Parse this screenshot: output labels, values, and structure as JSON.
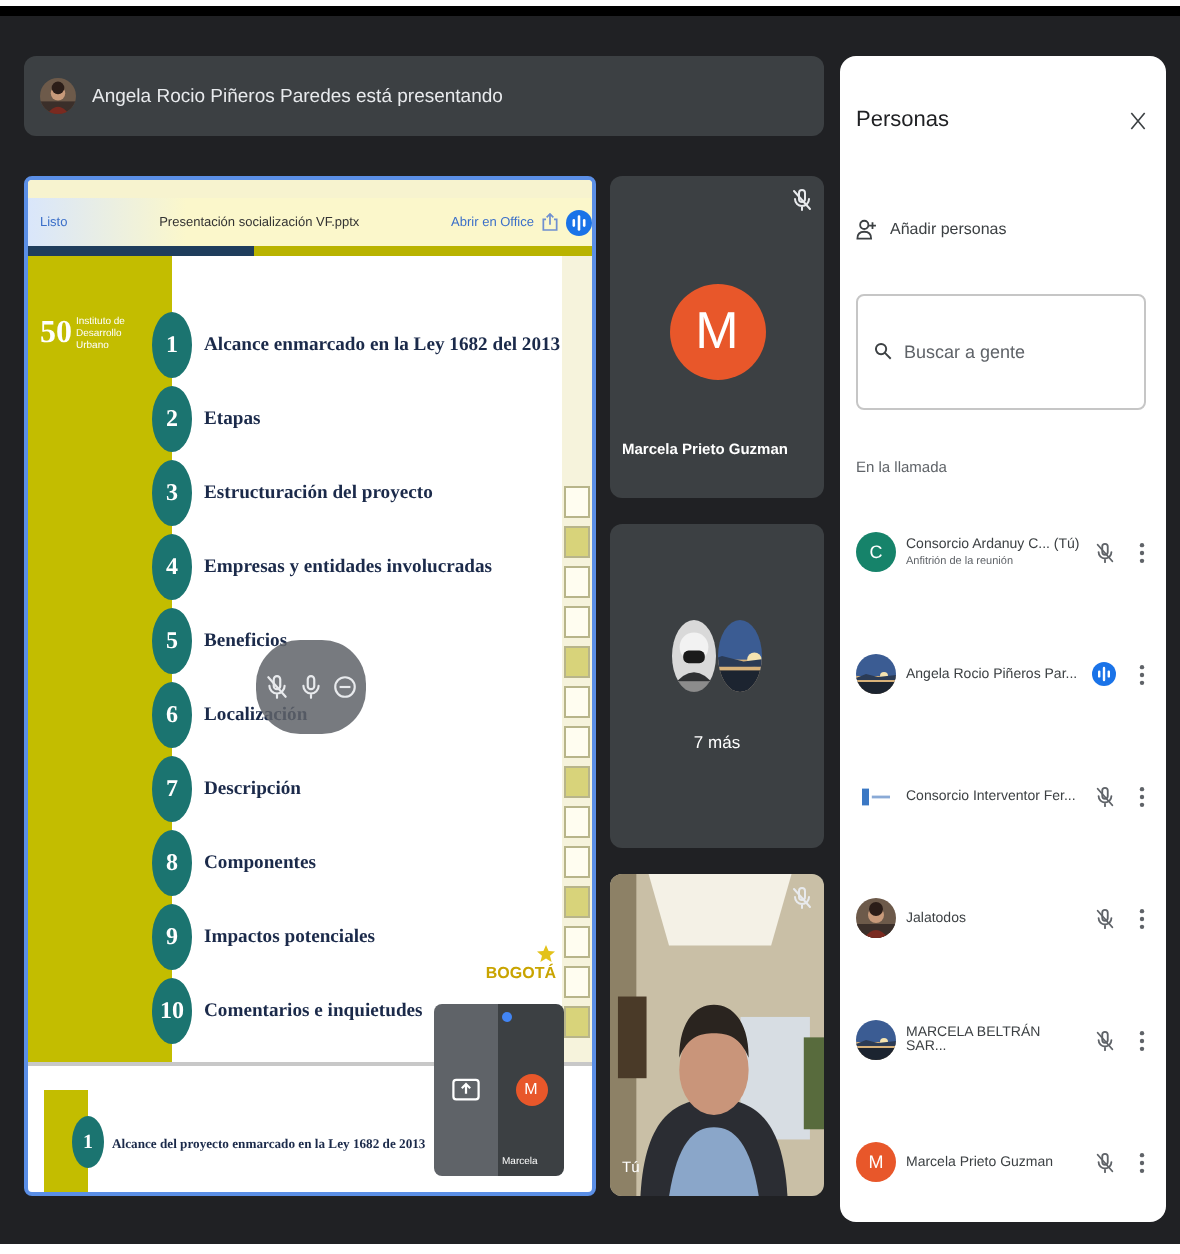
{
  "presenter_bar": {
    "text": "Angela Rocio Piñeros Paredes está presentando"
  },
  "presentation": {
    "app_bar": {
      "done": "Listo",
      "title": "Presentación socialización VF.pptx",
      "open_in": "Abrir en Office",
      "speaking": true
    },
    "slide": {
      "logo_number": "50",
      "logo_text": "Instituto de Desarrollo Urbano",
      "city_logo": "BOGOTÁ",
      "items": [
        {
          "number": "1",
          "text": "Alcance enmarcado en la Ley 1682 del 2013"
        },
        {
          "number": "2",
          "text": "Etapas"
        },
        {
          "number": "3",
          "text": "Estructuración del proyecto"
        },
        {
          "number": "4",
          "text": "Empresas y entidades involucradas"
        },
        {
          "number": "5",
          "text": "Beneficios"
        },
        {
          "number": "6",
          "text": "Localización"
        },
        {
          "number": "7",
          "text": "Descripción"
        },
        {
          "number": "8",
          "text": "Componentes"
        },
        {
          "number": "9",
          "text": "Impactos potenciales"
        },
        {
          "number": "10",
          "text": "Comentarios e inquietudes"
        }
      ]
    },
    "next_slide": {
      "number": "1",
      "text": "Alcance del proyecto enmarcado en la Ley 1682 de 2013"
    },
    "self_view": {
      "initial": "M",
      "name": "Marcela"
    }
  },
  "tiles": [
    {
      "kind": "avatar",
      "initial": "M",
      "color": "#e8572a",
      "name": "Marcela Prieto Guzman",
      "muted": true
    },
    {
      "kind": "group",
      "label": "7 más"
    },
    {
      "kind": "camera",
      "name": "Tú",
      "muted": true
    }
  ],
  "people_panel": {
    "title": "Personas",
    "add": "Añadir personas",
    "search": {
      "placeholder": "Buscar a gente"
    },
    "section": "En la llamada",
    "participants": [
      {
        "name": "Consorcio Ardanuy C... (Tú)",
        "role": "Anfitrión de la reunión",
        "avatar": {
          "kind": "letter",
          "initial": "C",
          "color": "#16836a"
        },
        "muted": true
      },
      {
        "name": "Angela Rocio Piñeros Par...",
        "muted": false
      },
      {
        "name": "Consorcio Interventor Fer...",
        "avatar": {
          "kind": "logo"
        },
        "muted": true
      },
      {
        "name": "Jalatodos",
        "muted": true
      },
      {
        "name": "MARCELA BELTRÁN SAR...",
        "muted": true
      },
      {
        "name": "Marcela Prieto Guzman",
        "avatar": {
          "kind": "letter",
          "initial": "M",
          "color": "#e8572a"
        },
        "muted": true
      }
    ]
  }
}
